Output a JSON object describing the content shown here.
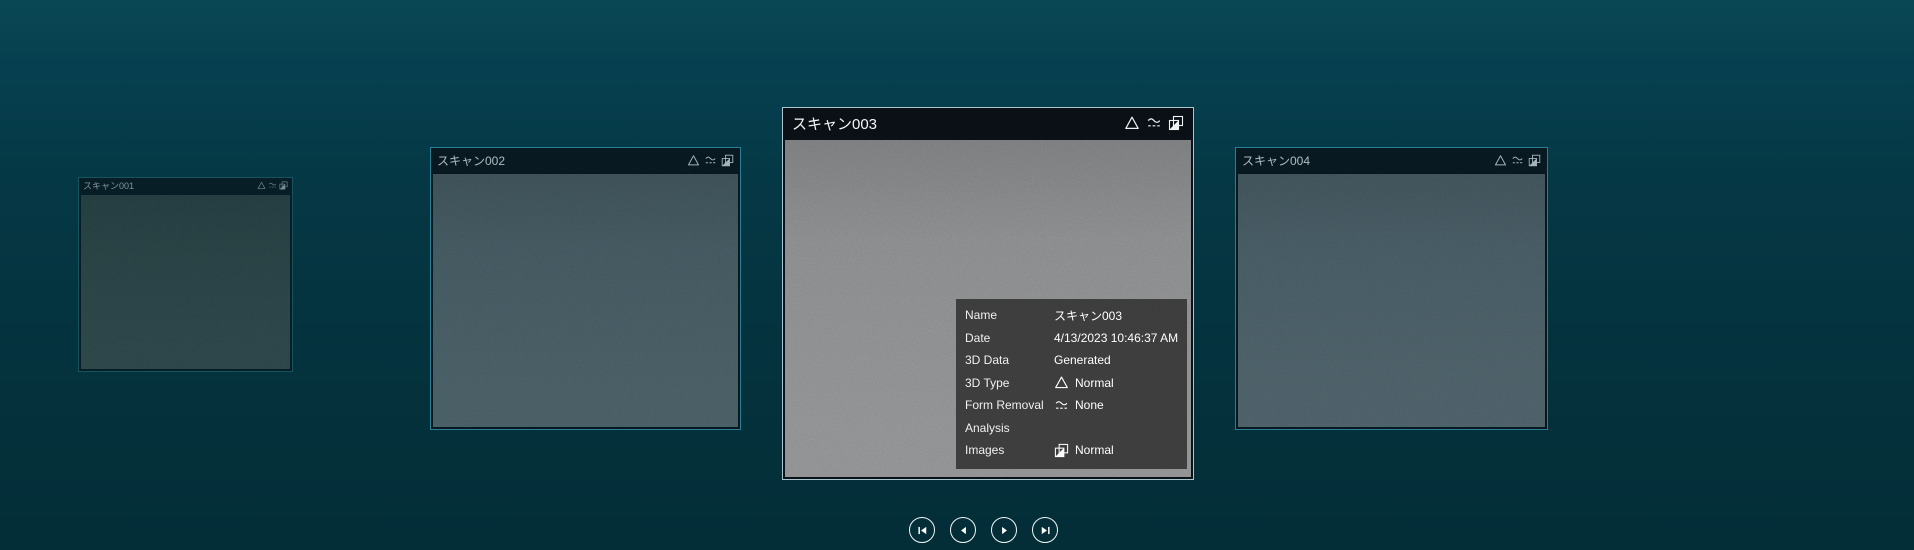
{
  "cards": [
    {
      "title": "スキャン001",
      "image_color": "#475550"
    },
    {
      "title": "スキャン002",
      "image_color": "#5a6a71"
    },
    {
      "title": "スキャン003",
      "image_color": "#8f9193"
    },
    {
      "title": "スキャン004",
      "image_color": "#5f6e76"
    }
  ],
  "card_icons": [
    "3d-type-triangle",
    "form-removal",
    "images"
  ],
  "info_panel": {
    "rows": [
      {
        "label": "Name",
        "value": "スキャン003",
        "icon": ""
      },
      {
        "label": "Date",
        "value": "4/13/2023 10:46:37 AM",
        "icon": ""
      },
      {
        "label": "3D Data",
        "value": "Generated",
        "icon": ""
      },
      {
        "label": "3D Type",
        "value": "Normal",
        "icon": "triangle-icon"
      },
      {
        "label": "Form Removal",
        "value": "None",
        "icon": "form-removal-icon"
      },
      {
        "label": "Analysis",
        "value": "",
        "icon": ""
      },
      {
        "label": "Images",
        "value": "Normal",
        "icon": "images-icon"
      }
    ]
  },
  "nav": {
    "buttons": [
      "skip-to-first",
      "previous",
      "next",
      "skip-to-last"
    ]
  },
  "colors": {
    "background": "#04313c",
    "card_focus_border": "#a9c6ce",
    "card_border": "#2b7f95",
    "card_dim_border": "#17525f",
    "titlebar_bg": "#0b131a",
    "panel_bg": "rgba(56,56,56,0.94)"
  }
}
